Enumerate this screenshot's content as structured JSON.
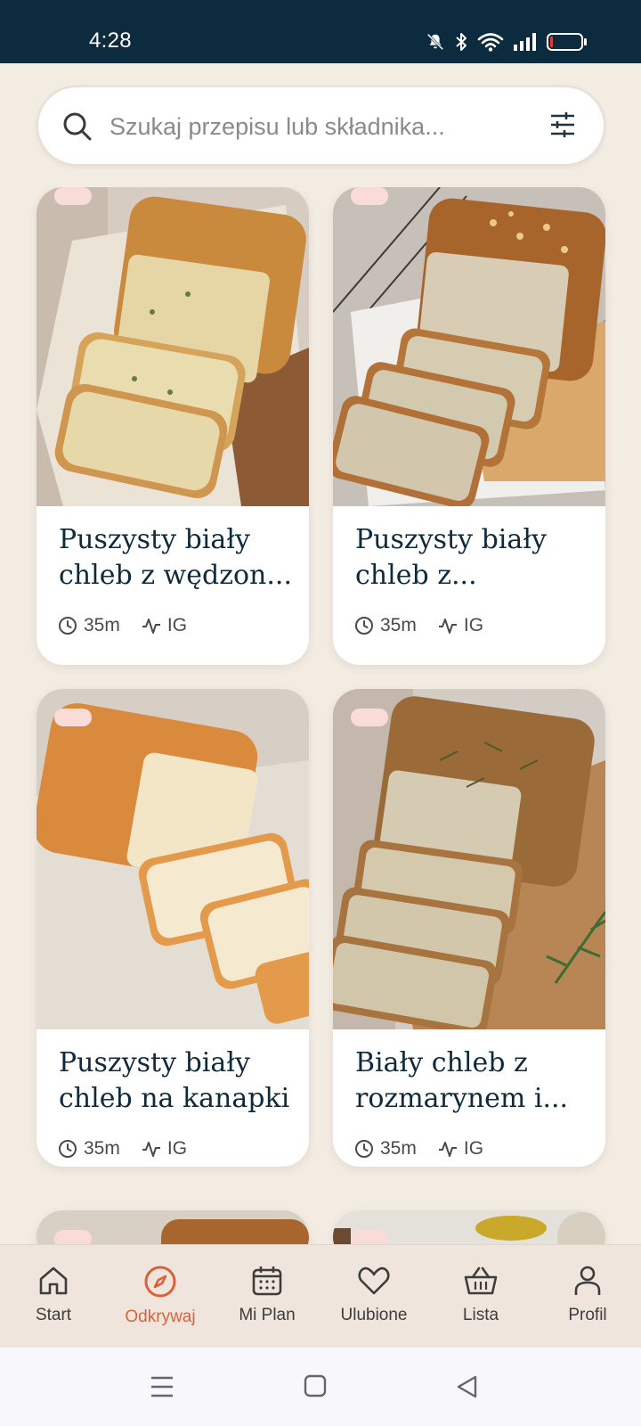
{
  "status_bar": {
    "time": "4:28",
    "icons": [
      "bell-off-icon",
      "bluetooth-icon",
      "wifi-icon",
      "signal-icon",
      "battery-low-icon"
    ],
    "battery_color": "#e53935"
  },
  "search": {
    "placeholder": "Szukaj przepisu lub składnika...",
    "value": "",
    "icon": "search-icon",
    "filter_icon": "filter-sliders-icon"
  },
  "recipes": [
    {
      "title": "Puszysty biały chleb z wędzon...",
      "time": "35m",
      "ig": "IG"
    },
    {
      "title": "Puszysty biały chleb z...",
      "time": "35m",
      "ig": "IG"
    },
    {
      "title": "Puszysty biały chleb na kanapki",
      "time": "35m",
      "ig": "IG"
    },
    {
      "title": "Biały chleb z rozmarynem i...",
      "time": "35m",
      "ig": "IG"
    }
  ],
  "bottom_nav": [
    {
      "label": "Start",
      "icon": "home-icon",
      "active": false
    },
    {
      "label": "Odkrywaj",
      "icon": "compass-icon",
      "active": true
    },
    {
      "label": "Mi Plan",
      "icon": "calendar-icon",
      "active": false
    },
    {
      "label": "Ulubione",
      "icon": "heart-icon",
      "active": false
    },
    {
      "label": "Lista",
      "icon": "basket-icon",
      "active": false
    },
    {
      "label": "Profil",
      "icon": "user-icon",
      "active": false
    }
  ],
  "colors": {
    "accent": "#d9623d",
    "background": "#f3ece3",
    "status_bar": "#0d2b3e",
    "badge": "#f9dcd8"
  },
  "system_nav": [
    "menu-icon",
    "home-square-icon",
    "back-triangle-icon"
  ]
}
